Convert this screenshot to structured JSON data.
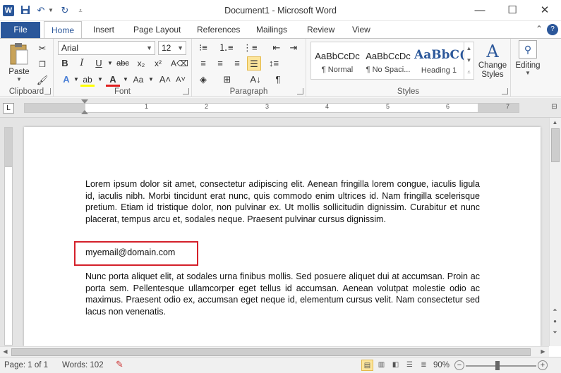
{
  "window": {
    "title": "Document1 - Microsoft Word",
    "app_icon": "W",
    "minimize": "—",
    "maximize": "☐",
    "close": "✕"
  },
  "ribbon_tabs": {
    "file": "File",
    "items": [
      "Home",
      "Insert",
      "Page Layout",
      "References",
      "Mailings",
      "Review",
      "View"
    ]
  },
  "clipboard": {
    "paste_label": "Paste",
    "group_label": "Clipboard"
  },
  "font": {
    "font_name": "Arial",
    "font_size": "12",
    "group_label": "Font"
  },
  "paragraph": {
    "group_label": "Paragraph"
  },
  "styles": {
    "items": [
      {
        "sample": "AaBbCcDc",
        "name": "¶ Normal"
      },
      {
        "sample": "AaBbCcDc",
        "name": "¶ No Spaci..."
      },
      {
        "sample": "AaBbC(",
        "name": "Heading 1"
      }
    ],
    "change_styles_label_1": "Change",
    "change_styles_label_2": "Styles",
    "group_label": "Styles"
  },
  "editing": {
    "label": "Editing"
  },
  "document": {
    "paragraph1": "Lorem ipsum dolor sit amet, consectetur adipiscing elit. Aenean fringilla lorem congue, iaculis ligula id, iaculis nibh. Morbi tincidunt erat nunc, quis commodo enim ultrices id. Nam fringilla scelerisque pretium. Etiam id tristique dolor, non pulvinar ex. Ut mollis sollicitudin dignissim. Curabitur et nunc placerat, tempus arcu et, sodales neque. Praesent pulvinar cursus dignissim.",
    "email": "myemail@domain.com",
    "paragraph2": "Nunc porta aliquet elit, at sodales urna finibus mollis. Sed posuere aliquet dui at accumsan. Proin ac porta sem. Pellentesque ullamcorper eget tellus id accumsan. Aenean volutpat molestie odio ac maximus. Praesent odio ex, accumsan eget neque id, elementum cursus velit. Nam consectetur sed lacus non venenatis."
  },
  "ruler_numbers": [
    "1",
    "2",
    "3",
    "4",
    "5",
    "6",
    "7"
  ],
  "status": {
    "page": "Page: 1 of 1",
    "words": "Words: 102",
    "zoom": "90%",
    "zoom_minus": "−",
    "zoom_plus": "+"
  },
  "colors": {
    "accent": "#2b579a",
    "highlight_box": "#d4202a"
  }
}
